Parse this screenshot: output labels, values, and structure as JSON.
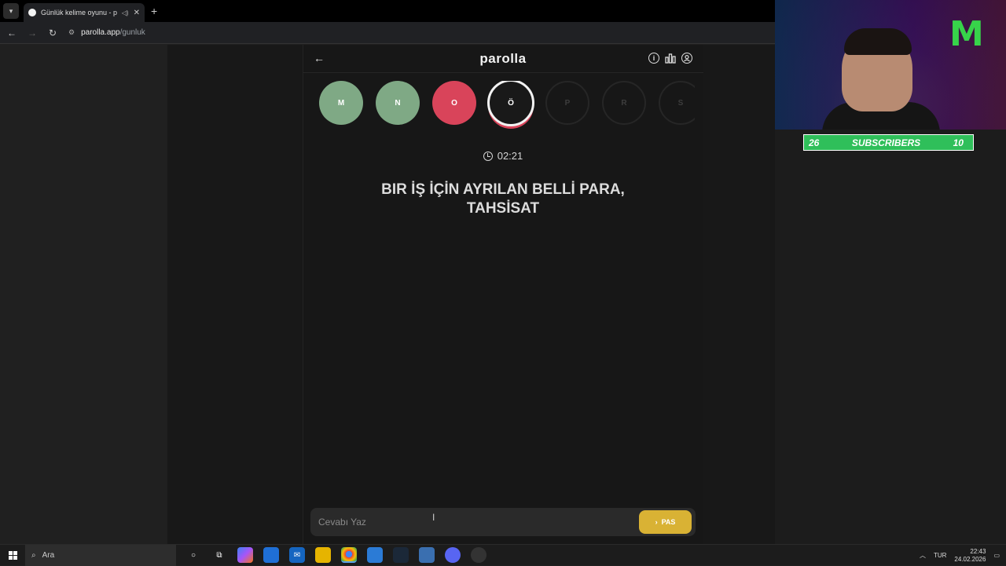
{
  "browser": {
    "tab_title": "Günlük kelime oyunu - parolla",
    "url_domain": "parolla.app",
    "url_path": "/gunluk"
  },
  "app": {
    "brand": "parolla",
    "letters": [
      {
        "char": "M",
        "state": "correct"
      },
      {
        "char": "N",
        "state": "correct"
      },
      {
        "char": "O",
        "state": "wrong"
      },
      {
        "char": "Ö",
        "state": "current"
      },
      {
        "char": "P",
        "state": "pending"
      },
      {
        "char": "R",
        "state": "pending"
      },
      {
        "char": "S",
        "state": "pending"
      }
    ],
    "timer": "02:21",
    "question": "BIR İŞ İÇİN AYRILAN BELLİ PARA, TAHSİSAT",
    "answer_placeholder": "Cevabı Yaz",
    "pass_label": "PAS"
  },
  "overlay": {
    "subs_left": "26",
    "subs_label": "SUBSCRIBERS",
    "subs_right": "10"
  },
  "taskbar": {
    "search_placeholder": "Ara",
    "language": "TUR",
    "time": "22:43",
    "date": "24.02.2026"
  },
  "colors": {
    "correct": "#7fa985",
    "wrong": "#d9445a",
    "pass_button": "#d9b234",
    "subs_bar": "#2fbf5a"
  }
}
